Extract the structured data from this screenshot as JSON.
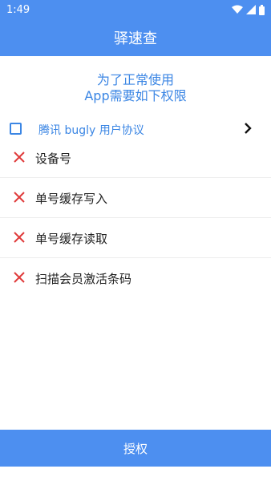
{
  "statusbar": {
    "time": "1:49",
    "icons": [
      "wifi-icon",
      "signal-icon",
      "battery-icon"
    ]
  },
  "appbar": {
    "title": "驿速查"
  },
  "intro": {
    "line1": "为了正常使用",
    "line2": "App需要如下权限"
  },
  "agreement": {
    "label": "腾讯 bugly 用户协议",
    "checked": false
  },
  "permissions": [
    {
      "label": "设备号",
      "granted": false
    },
    {
      "label": "单号缓存写入",
      "granted": false
    },
    {
      "label": "单号缓存读取",
      "granted": false
    },
    {
      "label": "扫描会员激活条码",
      "granted": false
    }
  ],
  "actions": {
    "authorize_label": "授权"
  },
  "colors": {
    "primary": "#4d8ff0",
    "link": "#3b86e4",
    "denied": "#e03a3a"
  }
}
